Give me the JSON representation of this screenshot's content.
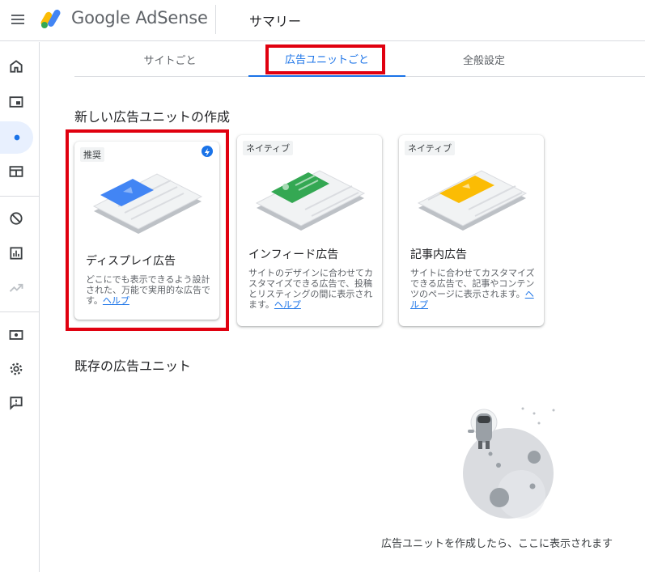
{
  "header": {
    "brand": "Google AdSense",
    "page_title": "サマリー"
  },
  "tabs": [
    {
      "label": "サイトごと"
    },
    {
      "label": "広告ユニットごと"
    },
    {
      "label": "全般設定"
    }
  ],
  "new_section_title": "新しい広告ユニットの作成",
  "cards": [
    {
      "tag": "推奨",
      "title": "ディスプレイ広告",
      "desc": "どこにでも表示できるよう設計された、万能で実用的な広告です。",
      "help": "ヘルプ",
      "accent": "#4285f4"
    },
    {
      "tag": "ネイティブ",
      "title": "インフィード広告",
      "desc": "サイトのデザインに合わせてカスタマイズできる広告で、投稿とリスティングの間に表示されます。",
      "help": "ヘルプ",
      "accent": "#34a853"
    },
    {
      "tag": "ネイティブ",
      "title": "記事内広告",
      "desc": "サイトに合わせてカスタマイズできる広告で、記事やコンテンツのページに表示されます。",
      "help": "ヘルプ",
      "accent": "#fbbc04"
    }
  ],
  "existing_section_title": "既存の広告ユニット",
  "empty_state": "広告ユニットを作成したら、ここに表示されます",
  "colors": {
    "accent": "#1a73e8",
    "highlight": "#e0000f"
  }
}
